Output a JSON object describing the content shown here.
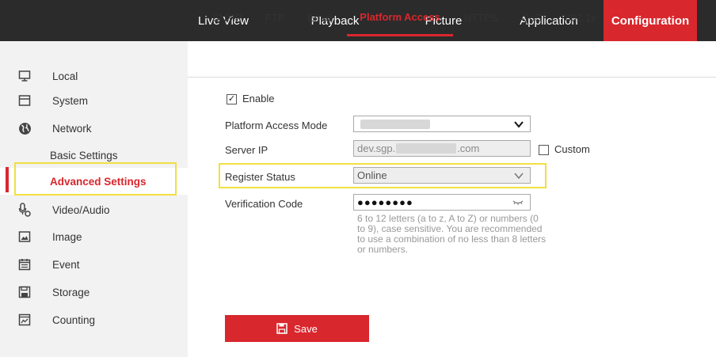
{
  "topnav": {
    "items": [
      {
        "label": "Live View"
      },
      {
        "label": "Playback"
      },
      {
        "label": "Picture"
      },
      {
        "label": "Application"
      },
      {
        "label": "Configuration"
      }
    ],
    "active": "Configuration"
  },
  "sidebar": {
    "items": [
      {
        "label": "Local",
        "icon": "monitor-icon"
      },
      {
        "label": "System",
        "icon": "system-icon"
      },
      {
        "label": "Network",
        "icon": "globe-icon"
      },
      {
        "label": "Basic Settings"
      },
      {
        "label": "Advanced Settings"
      },
      {
        "label": "Video/Audio",
        "icon": "microphone-camera-icon"
      },
      {
        "label": "Image",
        "icon": "image-icon"
      },
      {
        "label": "Event",
        "icon": "calendar-icon"
      },
      {
        "label": "Storage",
        "icon": "storage-icon"
      },
      {
        "label": "Counting",
        "icon": "counting-icon"
      }
    ],
    "selected": "Advanced Settings"
  },
  "tabs": {
    "items": [
      {
        "label": "SNMP"
      },
      {
        "label": "FTP"
      },
      {
        "label": "Email"
      },
      {
        "label": "Platform Access"
      },
      {
        "label": "HTTPS"
      },
      {
        "label": "QoS"
      },
      {
        "label": "802.1x"
      }
    ],
    "active": "Platform Access"
  },
  "form": {
    "enable_label": "Enable",
    "enable_checked": true,
    "mode_label": "Platform Access Mode",
    "server_ip_label": "Server IP",
    "server_ip_prefix": "dev.sgp.",
    "server_ip_suffix": ".com",
    "custom_label": "Custom",
    "custom_checked": false,
    "register_status_label": "Register Status",
    "register_status_value": "Online",
    "verification_label": "Verification Code",
    "verification_value": "●●●●●●●●",
    "help_text": "6 to 12 letters (a to z, A to Z) or numbers (0 to 9), case sensitive. You are recommended to use a combination of no less than 8 letters or numbers."
  },
  "save_label": "Save",
  "colors": {
    "accent": "#d8272d",
    "highlight": "#f0e040",
    "topbar": "#2b2b2b",
    "sidebar": "#f2f2f2"
  }
}
